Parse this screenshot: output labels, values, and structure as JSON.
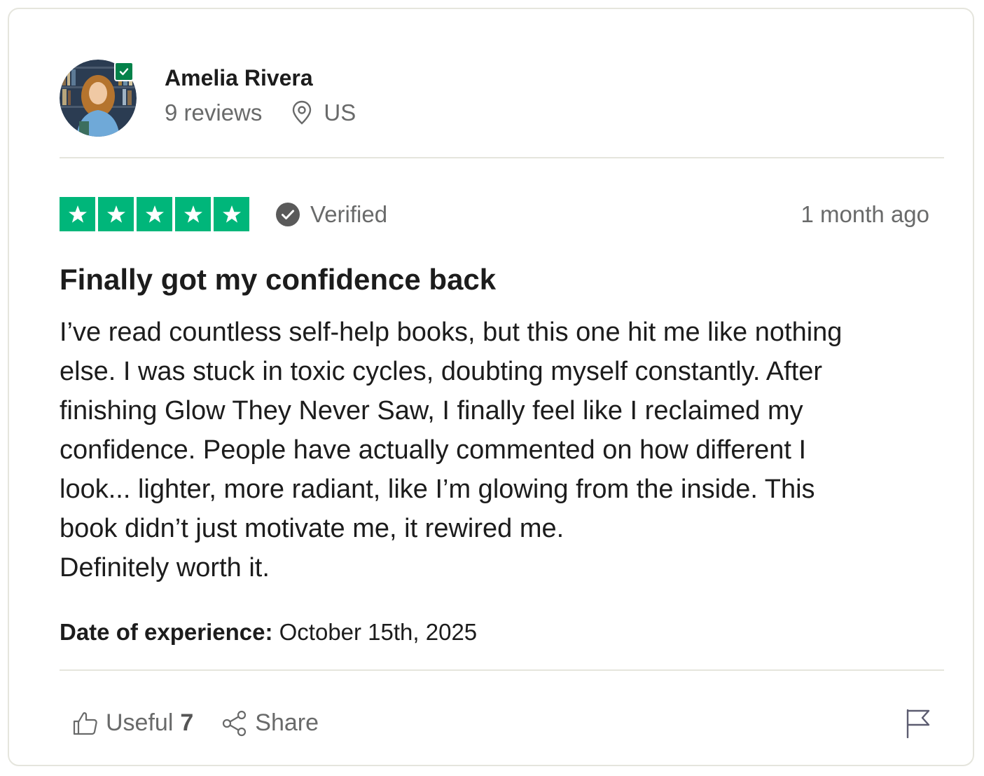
{
  "reviewer": {
    "name": "Amelia Rivera",
    "reviews_count": "9 reviews",
    "location": "US",
    "avatar_icon": "profile-photo",
    "verified_badge_icon": "check-icon"
  },
  "review": {
    "rating": 5,
    "rating_max": 5,
    "star_color": "#00b67a",
    "verified_label": "Verified",
    "time_ago": "1 month ago",
    "title": "Finally got my confidence back",
    "body": "I’ve read countless self-help books, but this one hit me like nothing\nelse. I was stuck in toxic cycles, doubting myself constantly. After\nfinishing Glow They Never Saw, I finally feel like I reclaimed my\nconfidence. People have actually commented on how different I\nlook... lighter, more radiant, like I’m glowing from the inside. This\nbook didn’t just motivate me, it rewired me.\nDefinitely worth it.",
    "experience_label": "Date of experience:",
    "experience_date": "October 15th, 2025"
  },
  "actions": {
    "useful_label": "Useful",
    "useful_count": "7",
    "share_label": "Share",
    "useful_icon": "thumbs-up-icon",
    "share_icon": "share-icon",
    "flag_icon": "flag-icon"
  },
  "colors": {
    "brand_green": "#00b67a",
    "badge_green": "#04824a",
    "text_primary": "#1c1c1c",
    "text_muted": "#696a6a",
    "divider": "#e5e5dd"
  }
}
